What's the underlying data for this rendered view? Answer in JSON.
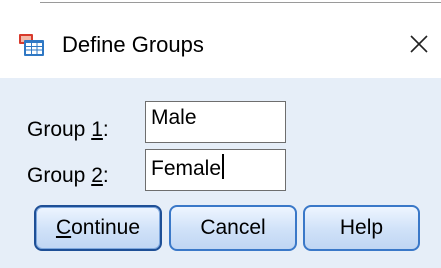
{
  "window": {
    "title": "Define Groups",
    "icon": "spss-dialog-icon",
    "close_glyph": "✕"
  },
  "groups": [
    {
      "label_prefix": "Group ",
      "label_key": "1",
      "label_suffix": ":",
      "value": "Male"
    },
    {
      "label_prefix": "Group ",
      "label_key": "2",
      "label_suffix": ":",
      "value": "Female"
    }
  ],
  "buttons": {
    "continue": {
      "mnemonic": "C",
      "rest": "ontinue"
    },
    "cancel": {
      "label": "Cancel"
    },
    "help": {
      "label": "Help"
    }
  },
  "colors": {
    "client_background": "#e6eef8",
    "button_border": "#3a78c8"
  }
}
